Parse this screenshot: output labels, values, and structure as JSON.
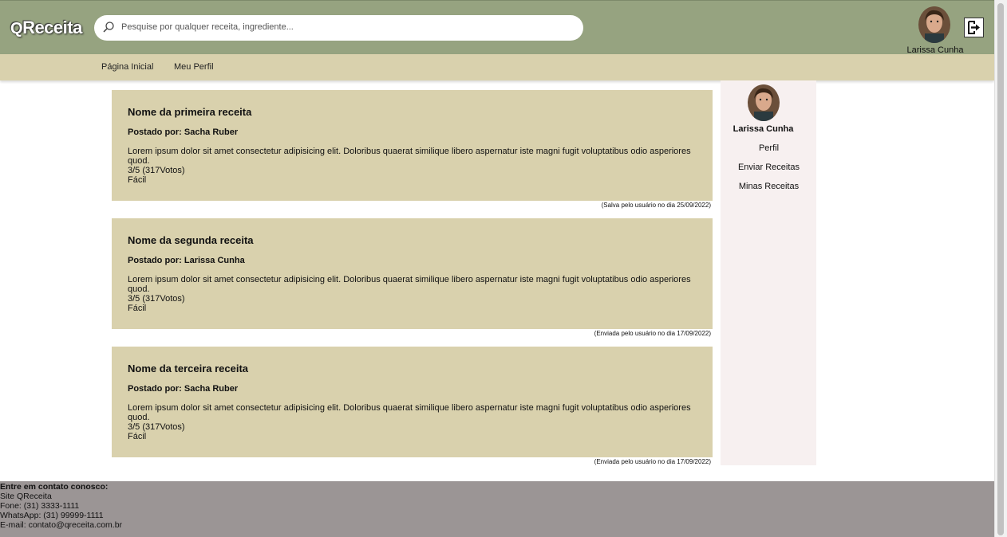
{
  "header": {
    "logo_q": "Q",
    "logo_rest": "Receita",
    "search_placeholder": "Pesquise por qualquer receita, ingrediente...",
    "user_name": "Larissa Cunha"
  },
  "nav": {
    "items": [
      {
        "label": "Página Inicial"
      },
      {
        "label": "Meu Perfil"
      }
    ]
  },
  "recipes": [
    {
      "title": "Nome da primeira receita",
      "author": "Postado por: Sacha Ruber",
      "description": "Lorem ipsum dolor sit amet consectetur adipisicing elit. Doloribus quaerat similique libero aspernatur iste magni fugit voluptatibus odio asperiores quod.",
      "rating": "3/5 (317Votos)",
      "difficulty": "Fácil",
      "note": "(Salva pelo usuário no dia 25/09/2022)"
    },
    {
      "title": "Nome da segunda receita",
      "author": "Postado por: Larissa Cunha",
      "description": "Lorem ipsum dolor sit amet consectetur adipisicing elit. Doloribus quaerat similique libero aspernatur iste magni fugit voluptatibus odio asperiores quod.",
      "rating": "3/5 (317Votos)",
      "difficulty": "Fácil",
      "note": "(Enviada pelo usuário no dia 17/09/2022)"
    },
    {
      "title": "Nome da terceira receita",
      "author": "Postado por: Sacha Ruber",
      "description": "Lorem ipsum dolor sit amet consectetur adipisicing elit. Doloribus quaerat similique libero aspernatur iste magni fugit voluptatibus odio asperiores quod.",
      "rating": "3/5 (317Votos)",
      "difficulty": "Fácil",
      "note": "(Enviada pelo usuário no dia 17/09/2022)"
    }
  ],
  "sidebar": {
    "name": "Larissa Cunha",
    "links": [
      {
        "label": "Perfil"
      },
      {
        "label": "Enviar Receitas"
      },
      {
        "label": "Minas Receitas"
      }
    ]
  },
  "footer": {
    "title": "Entre em contato conosco:",
    "lines": [
      "Site QReceita",
      "Fone: (31) 3333-1111",
      "WhatsApp: (31) 99999-1111",
      "E-mail: contato@qreceita.com.br"
    ]
  },
  "colors": {
    "header_bg": "#96a380",
    "nav_bg": "#d9d1ad",
    "card_bg": "#d9d1ad",
    "sidebar_bg": "#f7f0f0",
    "footer_bg": "#9b9595"
  }
}
